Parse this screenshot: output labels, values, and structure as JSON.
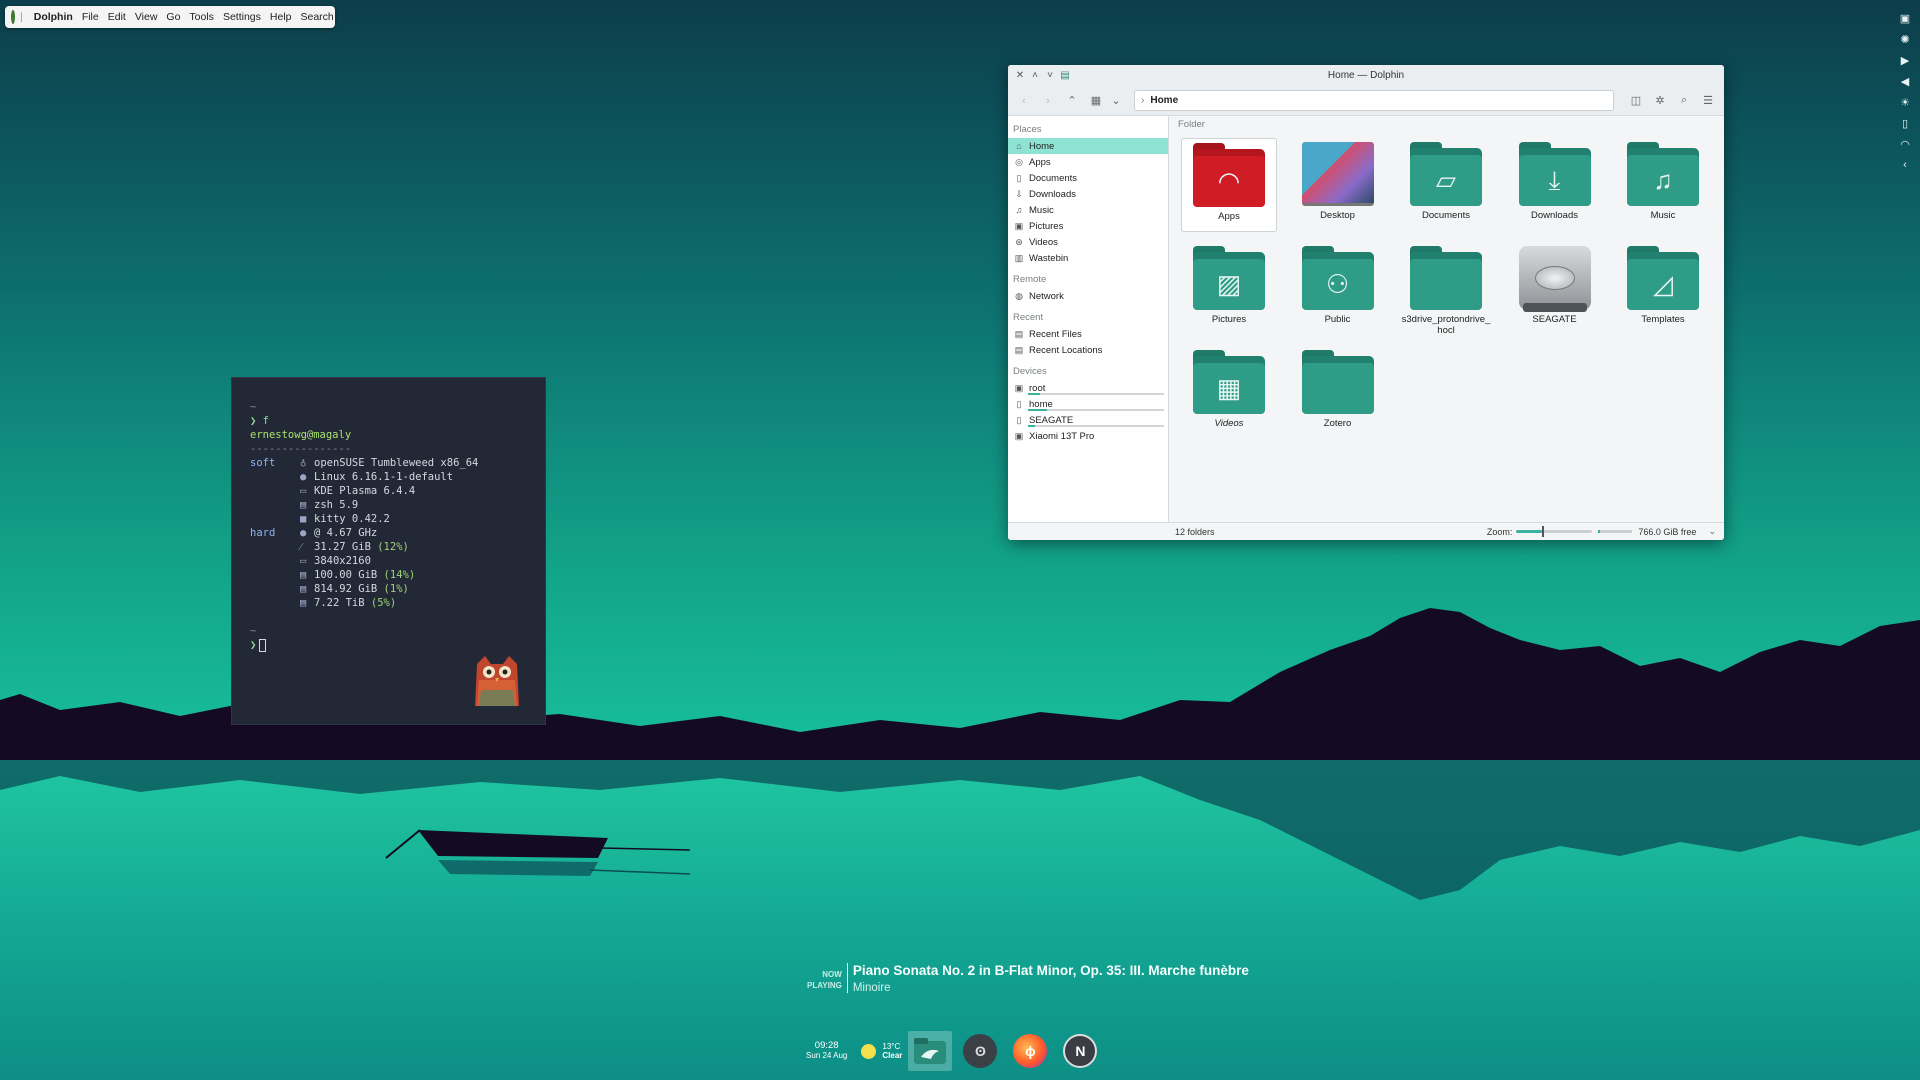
{
  "menubar": {
    "app_name": "Dolphin",
    "menu_items": [
      "File",
      "Edit",
      "View",
      "Go",
      "Tools",
      "Settings",
      "Help",
      "Search"
    ]
  },
  "tray_icons": [
    "notes-icon",
    "brightness-icon",
    "media-play-icon",
    "volume-icon",
    "sun-icon",
    "battery-icon",
    "wifi-icon",
    "chevron-left-icon"
  ],
  "terminal": {
    "tilde1": "~",
    "cmd_line": "❯ f",
    "user_host": "ernestowg@magaly",
    "divider": "----------------",
    "soft_label": "soft",
    "hard_label": "hard",
    "soft": [
      {
        "icon": "opensuse-icon",
        "glyph": "♁",
        "text": "openSUSE Tumbleweed x86_64"
      },
      {
        "icon": "linux-icon",
        "glyph": "●",
        "text": "Linux 6.16.1-1-default"
      },
      {
        "icon": "kde-icon",
        "glyph": "▭",
        "text": "KDE Plasma 6.4.4"
      },
      {
        "icon": "shell-icon",
        "glyph": "▤",
        "text": "zsh 5.9"
      },
      {
        "icon": "terminal-icon",
        "glyph": "■",
        "text": "kitty 0.42.2"
      }
    ],
    "hard": [
      {
        "icon": "cpu-icon",
        "glyph": "●",
        "text": "@ 4.67 GHz"
      },
      {
        "icon": "memory-icon",
        "glyph": "⁄",
        "text": "31.27 GiB",
        "pct": "(12%)"
      },
      {
        "icon": "display-icon",
        "glyph": "▭",
        "text": "3840x2160"
      },
      {
        "icon": "disk-icon",
        "glyph": "▤",
        "text": "100.00 GiB",
        "pct": "(14%)"
      },
      {
        "icon": "disk-icon",
        "glyph": "▤",
        "text": "814.92 GiB",
        "pct": "(1%)"
      },
      {
        "icon": "disk-icon",
        "glyph": "▤",
        "text": "7.22 TiB",
        "pct": "(5%)"
      }
    ],
    "tilde2": "~",
    "prompt": "❯"
  },
  "dolphin": {
    "title": "Home — Dolphin",
    "address": "Home",
    "view_header": "Folder",
    "places_sections": [
      {
        "title": "Places",
        "items": [
          {
            "label": "Home",
            "icon": "home-icon",
            "glyph": "⌂",
            "active": true
          },
          {
            "label": "Apps",
            "icon": "apps-icon",
            "glyph": "◎"
          },
          {
            "label": "Documents",
            "icon": "documents-icon",
            "glyph": "▯"
          },
          {
            "label": "Downloads",
            "icon": "downloads-icon",
            "glyph": "⇩"
          },
          {
            "label": "Music",
            "icon": "music-icon",
            "glyph": "♫"
          },
          {
            "label": "Pictures",
            "icon": "pictures-icon",
            "glyph": "▣"
          },
          {
            "label": "Videos",
            "icon": "videos-icon",
            "glyph": "⊛"
          },
          {
            "label": "Wastebin",
            "icon": "wastebin-icon",
            "glyph": "▥"
          }
        ]
      },
      {
        "title": "Remote",
        "items": [
          {
            "label": "Network",
            "icon": "network-icon",
            "glyph": "◍"
          }
        ]
      },
      {
        "title": "Recent",
        "items": [
          {
            "label": "Recent Files",
            "icon": "recent-files-icon",
            "glyph": "▤"
          },
          {
            "label": "Recent Locations",
            "icon": "recent-locations-icon",
            "glyph": "▤"
          }
        ]
      },
      {
        "title": "Devices",
        "items": [
          {
            "label": "root",
            "icon": "drive-icon",
            "glyph": "▣",
            "usage": 0.09
          },
          {
            "label": "home",
            "icon": "drive-icon",
            "glyph": "▯",
            "usage": 0.14
          },
          {
            "label": "SEAGATE",
            "icon": "drive-icon",
            "glyph": "▯",
            "usage": 0.05
          },
          {
            "label": "Xiaomi 13T Pro",
            "icon": "phone-icon",
            "glyph": "▣"
          }
        ]
      }
    ],
    "items": [
      {
        "name": "Apps",
        "kind": "folder-red",
        "glyph": "◠",
        "icon": "apps-folder-icon",
        "selected": true
      },
      {
        "name": "Desktop",
        "kind": "desktop",
        "icon": "desktop-folder-icon"
      },
      {
        "name": "Documents",
        "kind": "folder",
        "glyph": "▱",
        "icon": "documents-folder-icon"
      },
      {
        "name": "Downloads",
        "kind": "folder",
        "glyph": "⤓",
        "icon": "downloads-folder-icon"
      },
      {
        "name": "Music",
        "kind": "folder",
        "glyph": "♫",
        "icon": "music-folder-icon"
      },
      {
        "name": "Pictures",
        "kind": "folder",
        "glyph": "▨",
        "icon": "pictures-folder-icon"
      },
      {
        "name": "Public",
        "kind": "folder",
        "glyph": "⚇",
        "icon": "public-folder-icon"
      },
      {
        "name": "s3drive_protondrive_hocl",
        "kind": "folder",
        "glyph": "",
        "icon": "folder-icon"
      },
      {
        "name": "SEAGATE",
        "kind": "drive",
        "icon": "hard-drive-icon"
      },
      {
        "name": "Templates",
        "kind": "folder",
        "glyph": "◿",
        "icon": "templates-folder-icon"
      },
      {
        "name": "Videos",
        "kind": "folder",
        "glyph": "▦",
        "icon": "videos-folder-icon",
        "italic": true
      },
      {
        "name": "Zotero",
        "kind": "folder",
        "glyph": "",
        "icon": "folder-icon"
      }
    ],
    "status": {
      "count": "12 folders",
      "zoom_label": "Zoom:",
      "zoom_level": 0.34,
      "free": "766.0 GiB free",
      "used_fraction": 0.06
    }
  },
  "now_playing": {
    "label_now": "NOW",
    "label_playing": "PLAYING",
    "song": "Piano Sonata No. 2 in B-Flat Minor, Op. 35: III. Marche funèbre",
    "artist": "Minoire"
  },
  "dock": {
    "time": "09:28",
    "date": "Sun 24 Aug",
    "temp": "13°C",
    "condition": "Clear",
    "apps": [
      {
        "name": "dolphin-app-icon",
        "active": true
      },
      {
        "name": "cat-app-icon"
      },
      {
        "name": "firefox-app-icon"
      },
      {
        "name": "notion-app-icon"
      }
    ]
  },
  "colors": {
    "accent": "#3db1a0",
    "selection": "#8ee3d3",
    "folder": "#2e9c86",
    "folder_red": "#d01c24"
  }
}
